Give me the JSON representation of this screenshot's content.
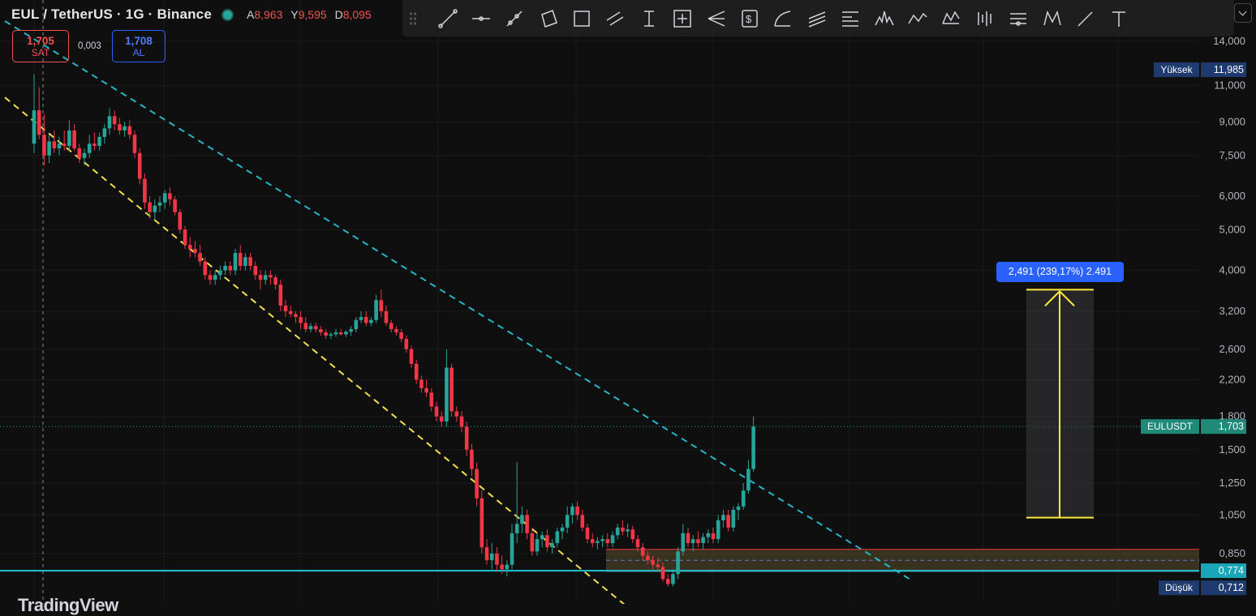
{
  "header": {
    "symbol": "EUL / TetherUS · 1G · Binance",
    "stats": [
      {
        "k": "A",
        "v": "8,963"
      },
      {
        "k": "Y",
        "v": "9,595"
      },
      {
        "k": "D",
        "v": "8,095"
      }
    ]
  },
  "trade": {
    "sell_price": "1,705",
    "sell_label": "SAT",
    "spread": "0,003",
    "buy_price": "1,708",
    "buy_label": "AL"
  },
  "toolbar": {
    "tools": [
      "trend-line-icon",
      "horizontal-ray-icon",
      "ray-icon",
      "rotated-rectangle-icon",
      "rectangle-icon",
      "parallel-channel-icon",
      "price-range-icon",
      "date-price-range-icon",
      "pitchfork-icon",
      "long-position-icon",
      "arc-icon",
      "fib-channel-icon",
      "fib-retracement-icon",
      "head-shoulders-icon",
      "xabcd-pattern-icon",
      "elliott-wave-icon",
      "bar-pattern-icon",
      "fib-speed-icon",
      "cypher-pattern-icon",
      "brush-icon",
      "text-icon"
    ]
  },
  "price_axis": {
    "ticks": [
      "14,000",
      "11,000",
      "9,000",
      "7,500",
      "6,000",
      "5,000",
      "4,000",
      "3,200",
      "2,600",
      "2,200",
      "1,800",
      "1,500",
      "1,250",
      "1,050",
      "0,850"
    ],
    "high_label": "Yüksek",
    "high_value": "11,985",
    "last_label": "EULUSDT",
    "last_value": "1,703",
    "line_value": "0,774",
    "low_label": "Düşük",
    "low_value": "0,712"
  },
  "measure_label": "2,491 (239,17%) 2.491",
  "watermark": "TradingView",
  "colors": {
    "up": "#26a69a",
    "down": "#f23645",
    "channel_upper": "#26b5c7",
    "channel_lower": "#f2e04a",
    "arrow": "#ffeb3b",
    "support_line": "#22c3d6",
    "measure": "#2962ff",
    "bg": "#0f0f0f"
  },
  "chart_data": {
    "type": "candlestick",
    "ylabel_scale": "log",
    "ylim": [
      0.65,
      15.5
    ],
    "x": "days",
    "candles": [
      [
        8.0,
        11.7,
        7.6,
        9.6
      ],
      [
        9.6,
        10.9,
        8.2,
        8.4
      ],
      [
        8.4,
        9.4,
        7.1,
        7.5
      ],
      [
        7.5,
        8.4,
        7.2,
        8.1
      ],
      [
        8.1,
        8.6,
        7.6,
        7.8
      ],
      [
        7.8,
        8.3,
        7.5,
        8.0
      ],
      [
        8.0,
        8.6,
        7.7,
        7.9
      ],
      [
        7.9,
        9.1,
        7.7,
        8.6
      ],
      [
        8.6,
        8.9,
        7.7,
        7.8
      ],
      [
        7.8,
        8.0,
        7.2,
        7.4
      ],
      [
        7.4,
        7.8,
        7.1,
        7.6
      ],
      [
        7.6,
        8.4,
        7.4,
        8.0
      ],
      [
        8.0,
        8.5,
        7.7,
        7.9
      ],
      [
        7.9,
        8.5,
        7.7,
        8.3
      ],
      [
        8.3,
        8.9,
        8.0,
        8.7
      ],
      [
        8.7,
        9.7,
        8.4,
        9.3
      ],
      [
        9.3,
        9.6,
        8.6,
        8.9
      ],
      [
        8.9,
        9.2,
        8.4,
        8.6
      ],
      [
        8.6,
        9.0,
        8.3,
        8.8
      ],
      [
        8.8,
        9.1,
        8.2,
        8.4
      ],
      [
        8.4,
        8.6,
        7.4,
        7.6
      ],
      [
        7.6,
        7.8,
        6.4,
        6.6
      ],
      [
        6.6,
        6.8,
        5.6,
        5.8
      ],
      [
        5.8,
        6.0,
        5.3,
        5.5
      ],
      [
        5.5,
        5.9,
        5.3,
        5.7
      ],
      [
        5.7,
        6.0,
        5.5,
        5.8
      ],
      [
        5.8,
        6.2,
        5.6,
        6.1
      ],
      [
        6.1,
        6.3,
        5.7,
        5.9
      ],
      [
        5.9,
        6.0,
        5.4,
        5.5
      ],
      [
        5.5,
        5.6,
        4.9,
        5.0
      ],
      [
        5.0,
        5.1,
        4.5,
        4.6
      ],
      [
        4.6,
        4.8,
        4.3,
        4.5
      ],
      [
        4.5,
        4.7,
        4.3,
        4.4
      ],
      [
        4.4,
        4.6,
        4.1,
        4.2
      ],
      [
        4.2,
        4.3,
        3.8,
        3.9
      ],
      [
        3.9,
        4.0,
        3.7,
        3.8
      ],
      [
        3.8,
        4.0,
        3.7,
        3.9
      ],
      [
        3.9,
        4.1,
        3.8,
        4.0
      ],
      [
        4.0,
        4.2,
        3.9,
        4.1
      ],
      [
        4.1,
        4.2,
        3.9,
        4.0
      ],
      [
        4.0,
        4.5,
        3.9,
        4.4
      ],
      [
        4.4,
        4.6,
        4.0,
        4.1
      ],
      [
        4.1,
        4.4,
        4.0,
        4.3
      ],
      [
        4.3,
        4.4,
        4.0,
        4.1
      ],
      [
        4.1,
        4.2,
        3.8,
        3.9
      ],
      [
        3.9,
        4.0,
        3.6,
        3.8
      ],
      [
        3.8,
        4.0,
        3.7,
        3.9
      ],
      [
        3.9,
        4.0,
        3.7,
        3.85
      ],
      [
        3.85,
        3.9,
        3.6,
        3.7
      ],
      [
        3.7,
        3.8,
        3.2,
        3.3
      ],
      [
        3.3,
        3.4,
        3.1,
        3.2
      ],
      [
        3.2,
        3.3,
        3.1,
        3.15
      ],
      [
        3.15,
        3.2,
        3.0,
        3.1
      ],
      [
        3.1,
        3.2,
        2.9,
        3.0
      ],
      [
        3.0,
        3.1,
        2.85,
        2.9
      ],
      [
        2.9,
        3.0,
        2.85,
        2.95
      ],
      [
        2.95,
        3.0,
        2.85,
        2.9
      ],
      [
        2.9,
        2.95,
        2.8,
        2.85
      ],
      [
        2.85,
        2.9,
        2.75,
        2.8
      ],
      [
        2.8,
        2.85,
        2.75,
        2.82
      ],
      [
        2.82,
        2.9,
        2.78,
        2.85
      ],
      [
        2.85,
        2.9,
        2.8,
        2.82
      ],
      [
        2.82,
        2.88,
        2.78,
        2.86
      ],
      [
        2.86,
        2.95,
        2.8,
        2.9
      ],
      [
        2.9,
        3.1,
        2.85,
        3.05
      ],
      [
        3.05,
        3.2,
        3.0,
        3.1
      ],
      [
        3.1,
        3.2,
        2.95,
        3.0
      ],
      [
        3.0,
        3.1,
        2.95,
        3.05
      ],
      [
        3.05,
        3.5,
        3.0,
        3.4
      ],
      [
        3.4,
        3.6,
        3.1,
        3.2
      ],
      [
        3.2,
        3.3,
        2.95,
        3.0
      ],
      [
        3.0,
        3.05,
        2.85,
        2.9
      ],
      [
        2.9,
        2.95,
        2.8,
        2.85
      ],
      [
        2.85,
        2.9,
        2.7,
        2.75
      ],
      [
        2.75,
        2.8,
        2.55,
        2.6
      ],
      [
        2.6,
        2.65,
        2.35,
        2.4
      ],
      [
        2.4,
        2.45,
        2.15,
        2.2
      ],
      [
        2.2,
        2.25,
        2.05,
        2.1
      ],
      [
        2.1,
        2.2,
        2.0,
        2.05
      ],
      [
        2.05,
        2.1,
        1.85,
        1.9
      ],
      [
        1.9,
        1.95,
        1.75,
        1.8
      ],
      [
        1.8,
        1.85,
        1.7,
        1.75
      ],
      [
        1.75,
        2.6,
        1.7,
        2.35
      ],
      [
        2.35,
        2.4,
        1.8,
        1.85
      ],
      [
        1.85,
        1.9,
        1.75,
        1.8
      ],
      [
        1.8,
        1.85,
        1.65,
        1.7
      ],
      [
        1.7,
        1.75,
        1.45,
        1.5
      ],
      [
        1.5,
        1.55,
        1.3,
        1.35
      ],
      [
        1.35,
        1.4,
        1.1,
        1.15
      ],
      [
        1.15,
        1.2,
        0.85,
        0.88
      ],
      [
        0.88,
        0.92,
        0.8,
        0.82
      ],
      [
        0.82,
        0.9,
        0.78,
        0.85
      ],
      [
        0.85,
        0.88,
        0.77,
        0.8
      ],
      [
        0.8,
        0.84,
        0.76,
        0.78
      ],
      [
        0.78,
        0.82,
        0.75,
        0.8
      ],
      [
        0.8,
        1.0,
        0.78,
        0.95
      ],
      [
        0.95,
        1.4,
        0.9,
        1.0
      ],
      [
        1.0,
        1.1,
        0.95,
        1.05
      ],
      [
        1.05,
        1.08,
        0.92,
        0.95
      ],
      [
        0.95,
        0.98,
        0.84,
        0.86
      ],
      [
        0.86,
        0.95,
        0.84,
        0.92
      ],
      [
        0.92,
        0.96,
        0.88,
        0.94
      ],
      [
        0.94,
        0.97,
        0.86,
        0.88
      ],
      [
        0.88,
        0.92,
        0.85,
        0.9
      ],
      [
        0.9,
        0.98,
        0.88,
        0.96
      ],
      [
        0.96,
        1.0,
        0.92,
        0.98
      ],
      [
        0.98,
        1.1,
        0.95,
        1.05
      ],
      [
        1.05,
        1.12,
        1.0,
        1.1
      ],
      [
        1.1,
        1.13,
        1.02,
        1.05
      ],
      [
        1.05,
        1.08,
        0.96,
        0.98
      ],
      [
        0.98,
        1.0,
        0.9,
        0.92
      ],
      [
        0.92,
        0.95,
        0.88,
        0.9
      ],
      [
        0.9,
        0.93,
        0.87,
        0.91
      ],
      [
        0.91,
        0.94,
        0.88,
        0.92
      ],
      [
        0.92,
        0.95,
        0.88,
        0.9
      ],
      [
        0.9,
        0.96,
        0.88,
        0.94
      ],
      [
        0.94,
        1.0,
        0.92,
        0.98
      ],
      [
        0.98,
        1.02,
        0.94,
        0.96
      ],
      [
        0.96,
        1.0,
        0.93,
        0.97
      ],
      [
        0.97,
        0.99,
        0.9,
        0.92
      ],
      [
        0.92,
        0.94,
        0.86,
        0.88
      ],
      [
        0.88,
        0.9,
        0.82,
        0.84
      ],
      [
        0.84,
        0.86,
        0.8,
        0.82
      ],
      [
        0.82,
        0.84,
        0.78,
        0.8
      ],
      [
        0.8,
        0.83,
        0.77,
        0.79
      ],
      [
        0.79,
        0.81,
        0.73,
        0.74
      ],
      [
        0.74,
        0.76,
        0.71,
        0.72
      ],
      [
        0.72,
        0.78,
        0.71,
        0.76
      ],
      [
        0.76,
        0.88,
        0.74,
        0.86
      ],
      [
        0.86,
        1.0,
        0.84,
        0.95
      ],
      [
        0.95,
        0.98,
        0.88,
        0.9
      ],
      [
        0.9,
        0.94,
        0.86,
        0.92
      ],
      [
        0.92,
        0.96,
        0.88,
        0.9
      ],
      [
        0.9,
        0.95,
        0.87,
        0.93
      ],
      [
        0.93,
        0.97,
        0.9,
        0.95
      ],
      [
        0.95,
        0.98,
        0.9,
        0.92
      ],
      [
        0.92,
        1.05,
        0.9,
        1.02
      ],
      [
        1.02,
        1.08,
        0.98,
        1.05
      ],
      [
        1.05,
        1.08,
        0.96,
        0.98
      ],
      [
        0.98,
        1.1,
        0.96,
        1.08
      ],
      [
        1.08,
        1.12,
        1.02,
        1.1
      ],
      [
        1.1,
        1.25,
        1.08,
        1.2
      ],
      [
        1.2,
        1.42,
        1.18,
        1.35
      ],
      [
        1.35,
        1.8,
        1.33,
        1.703
      ]
    ],
    "upper_channel": {
      "from": [
        0,
        14.0
      ],
      "to": [
        174,
        0.74
      ]
    },
    "lower_channel": {
      "from": [
        0,
        9.1
      ],
      "to": [
        119,
        0.62
      ]
    },
    "support_zone": [
      0.772,
      0.87
    ],
    "support_line": 0.774,
    "target_arrow": {
      "from": 1.035,
      "to": 3.6
    }
  }
}
